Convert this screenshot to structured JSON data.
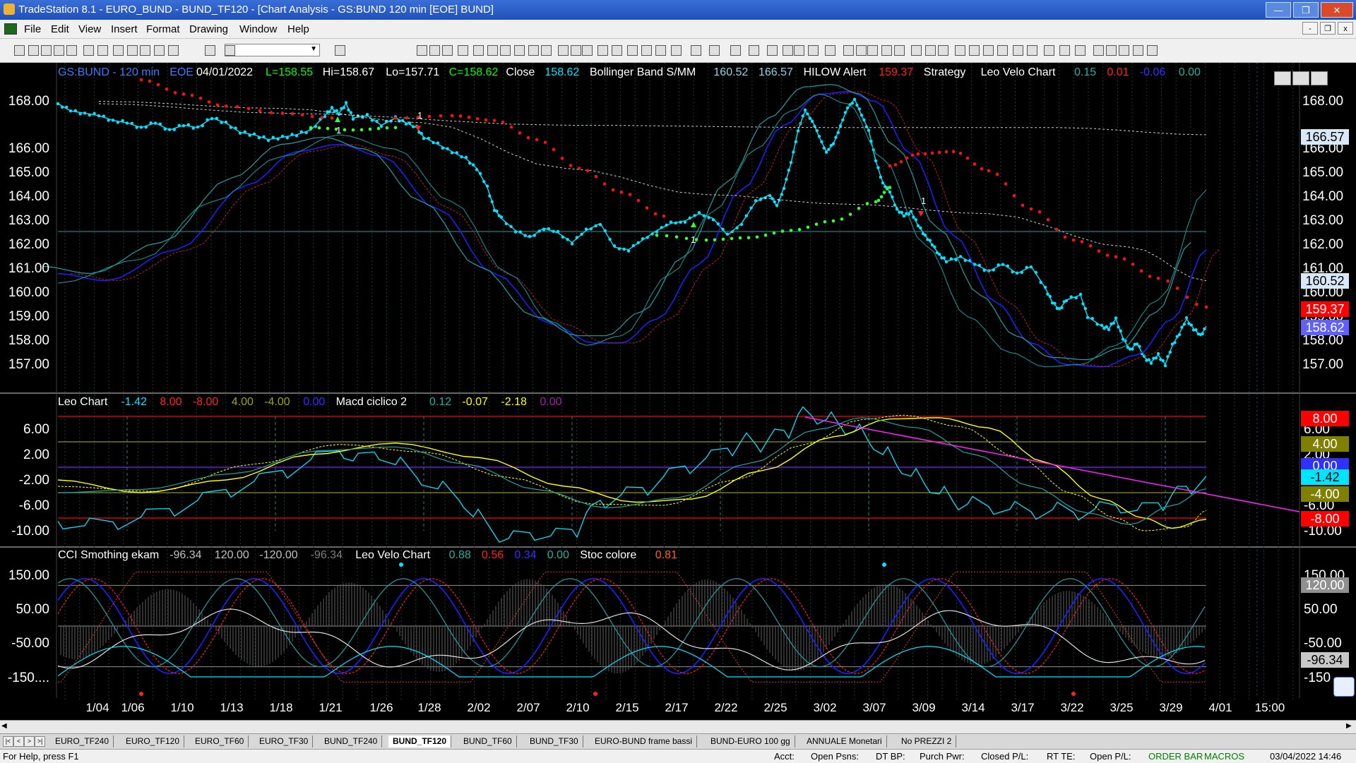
{
  "window": {
    "title": "TradeStation 8.1 - EURO_BUND - BUND_TF120 - [Chart Analysis - GS:BUND  120 min  [EOE] BUND]",
    "minimize": "—",
    "restore": "❐",
    "close": "✕"
  },
  "menu": [
    "File",
    "Edit",
    "View",
    "Insert",
    "Format",
    "Drawing",
    "Window",
    "Help"
  ],
  "mdi": {
    "minimize": "-",
    "restore": "❐",
    "close": "x"
  },
  "price_panel": {
    "header": [
      {
        "text": "GS:BUND - 120 min",
        "color": "#3a7bff"
      },
      {
        "text": "EOE",
        "color": "#3a7bff"
      },
      {
        "text": "04/01/2022",
        "color": "#ffffff"
      },
      {
        "text": "L=158.55",
        "color": "#00ff00"
      },
      {
        "text": "Hi=158.67",
        "color": "#ffffff"
      },
      {
        "text": "Lo=157.71",
        "color": "#ffffff"
      },
      {
        "text": "C=158.62",
        "color": "#00ff00"
      },
      {
        "text": "Close",
        "color": "#ffffff"
      },
      {
        "text": "158.62",
        "color": "#00e5ff"
      },
      {
        "text": "Bollinger Band S/MM",
        "color": "#ffffff"
      },
      {
        "text": "160.52",
        "color": "#8fd3e8"
      },
      {
        "text": "166.57",
        "color": "#8fd3e8"
      },
      {
        "text": "HILOW Alert",
        "color": "#ffffff"
      },
      {
        "text": "159.37",
        "color": "#ff2020"
      },
      {
        "text": "Strategy",
        "color": "#ffffff"
      },
      {
        "text": "Leo Velo Chart",
        "color": "#ffffff"
      },
      {
        "text": "0.15",
        "color": "#20b0a0"
      },
      {
        "text": "0.01",
        "color": "#ff2020"
      },
      {
        "text": "-0.06",
        "color": "#3030ff"
      },
      {
        "text": "0.00",
        "color": "#20b0a0"
      }
    ],
    "y_ticks": [
      "168.00",
      "166.00",
      "165.00",
      "164.00",
      "163.00",
      "162.00",
      "161.00",
      "160.00",
      "159.00",
      "158.00",
      "157.00"
    ],
    "badges": [
      {
        "text": "166.57",
        "bg": "#d8e8f8",
        "fg": "#000000"
      },
      {
        "text": "160.52",
        "bg": "#d8e8f8",
        "fg": "#000000"
      },
      {
        "text": "159.37",
        "bg": "#ff0000",
        "fg": "#ffffff"
      },
      {
        "text": "158.62",
        "bg": "#6060ff",
        "fg": "#ffffff"
      }
    ],
    "annotations": [
      "1",
      "1",
      "1",
      "1"
    ]
  },
  "osc_panel": {
    "header": [
      {
        "text": "Leo Chart",
        "color": "#ffffff"
      },
      {
        "text": "-1.42",
        "color": "#00e5ff"
      },
      {
        "text": "8.00",
        "color": "#ff2020"
      },
      {
        "text": "-8.00",
        "color": "#ff2020"
      },
      {
        "text": "4.00",
        "color": "#a0a020"
      },
      {
        "text": "-4.00",
        "color": "#a0a020"
      },
      {
        "text": "0.00",
        "color": "#3030ff"
      },
      {
        "text": "Macd ciclico 2",
        "color": "#ffffff"
      },
      {
        "text": "0.12",
        "color": "#20b0a0"
      },
      {
        "text": "-0.07",
        "color": "#ffff00"
      },
      {
        "text": "-2.18",
        "color": "#ffff00"
      },
      {
        "text": "0.00",
        "color": "#a020a0"
      }
    ],
    "y_ticks": [
      "6.00",
      "2.00",
      "-2.00",
      "-6.00",
      "-10.00"
    ],
    "right_labels": [
      "6.00",
      "2.00",
      "-6.00",
      "-10.00"
    ],
    "badges": [
      {
        "text": "8.00",
        "bg": "#ff0000",
        "fg": "#ffffff"
      },
      {
        "text": "4.00",
        "bg": "#808000",
        "fg": "#ffffff"
      },
      {
        "text": "0.00",
        "bg": "#3030ff",
        "fg": "#ffffff"
      },
      {
        "text": "-1.42",
        "bg": "#00e5ff",
        "fg": "#000000"
      },
      {
        "text": "-4.00",
        "bg": "#808000",
        "fg": "#ffffff"
      },
      {
        "text": "-8.00",
        "bg": "#ff0000",
        "fg": "#ffffff"
      }
    ]
  },
  "cci_panel": {
    "header": [
      {
        "text": "CCI Smothing ekam",
        "color": "#ffffff"
      },
      {
        "text": "-96.34",
        "color": "#c0c0c0"
      },
      {
        "text": "120.00",
        "color": "#c0c0c0"
      },
      {
        "text": "-120.00",
        "color": "#c0c0c0"
      },
      {
        "text": "-96.34",
        "color": "#808080"
      },
      {
        "text": "Leo Velo Chart",
        "color": "#ffffff"
      },
      {
        "text": "0.88",
        "color": "#20b0a0"
      },
      {
        "text": "0.56",
        "color": "#ff2020"
      },
      {
        "text": "0.34",
        "color": "#3030ff"
      },
      {
        "text": "0.00",
        "color": "#20b0a0"
      },
      {
        "text": "Stoc colore",
        "color": "#ffffff"
      },
      {
        "text": "0.81",
        "color": "#ff6020"
      }
    ],
    "y_ticks": [
      "150.00",
      "50.00",
      "-50.00",
      "-150...."
    ],
    "right_labels": [
      "150.00",
      "50.00",
      "-50.00",
      "-150"
    ],
    "badges": [
      {
        "text": "120.00",
        "bg": "#909090",
        "fg": "#ffffff"
      },
      {
        "text": "-96.34",
        "bg": "#c8c8c8",
        "fg": "#000000"
      }
    ]
  },
  "x_ticks": [
    "1/04",
    "1/06",
    "1/10",
    "1/13",
    "1/18",
    "1/21",
    "1/26",
    "1/28",
    "2/02",
    "2/07",
    "2/10",
    "2/15",
    "2/17",
    "2/22",
    "2/25",
    "3/02",
    "3/07",
    "3/09",
    "3/14",
    "3/17",
    "3/22",
    "3/25",
    "3/29",
    "4/01",
    "15:00"
  ],
  "tabs": [
    "EURO_TF240",
    "EURO_TF120",
    "EURO_TF60",
    "EURO_TF30",
    "BUND_TF240",
    "BUND_TF120",
    "BUND_TF60",
    "BUND_TF30",
    "EURO-BUND frame bassi",
    "BUND-EURO 100 gg",
    "ANNUALE Monetari",
    "No PREZZI 2"
  ],
  "active_tab": "BUND_TF120",
  "status": {
    "help": "For Help, press F1",
    "acct": "Acct:",
    "open_psns": "Open Psns:",
    "dt_bp": "DT BP:",
    "purch_pwr": "Purch Pwr:",
    "closed_pl": "Closed P/L:",
    "rt_te": "RT TE:",
    "open_pl": "Open P/L:",
    "order_bar": "ORDER BAR",
    "macros": "MACROS",
    "datetime": "03/04/2022 14:46"
  },
  "colors": {
    "price_dots": "#00e5ff",
    "hilow_red": "#ff1010",
    "hilow_green": "#30ff30",
    "blue_line": "#2020ff",
    "teal_line": "#20a0a0",
    "yellow_line": "#ffff00",
    "magenta_line": "#ff20ff",
    "level_red": "#ff0000",
    "level_olive": "#909020"
  }
}
